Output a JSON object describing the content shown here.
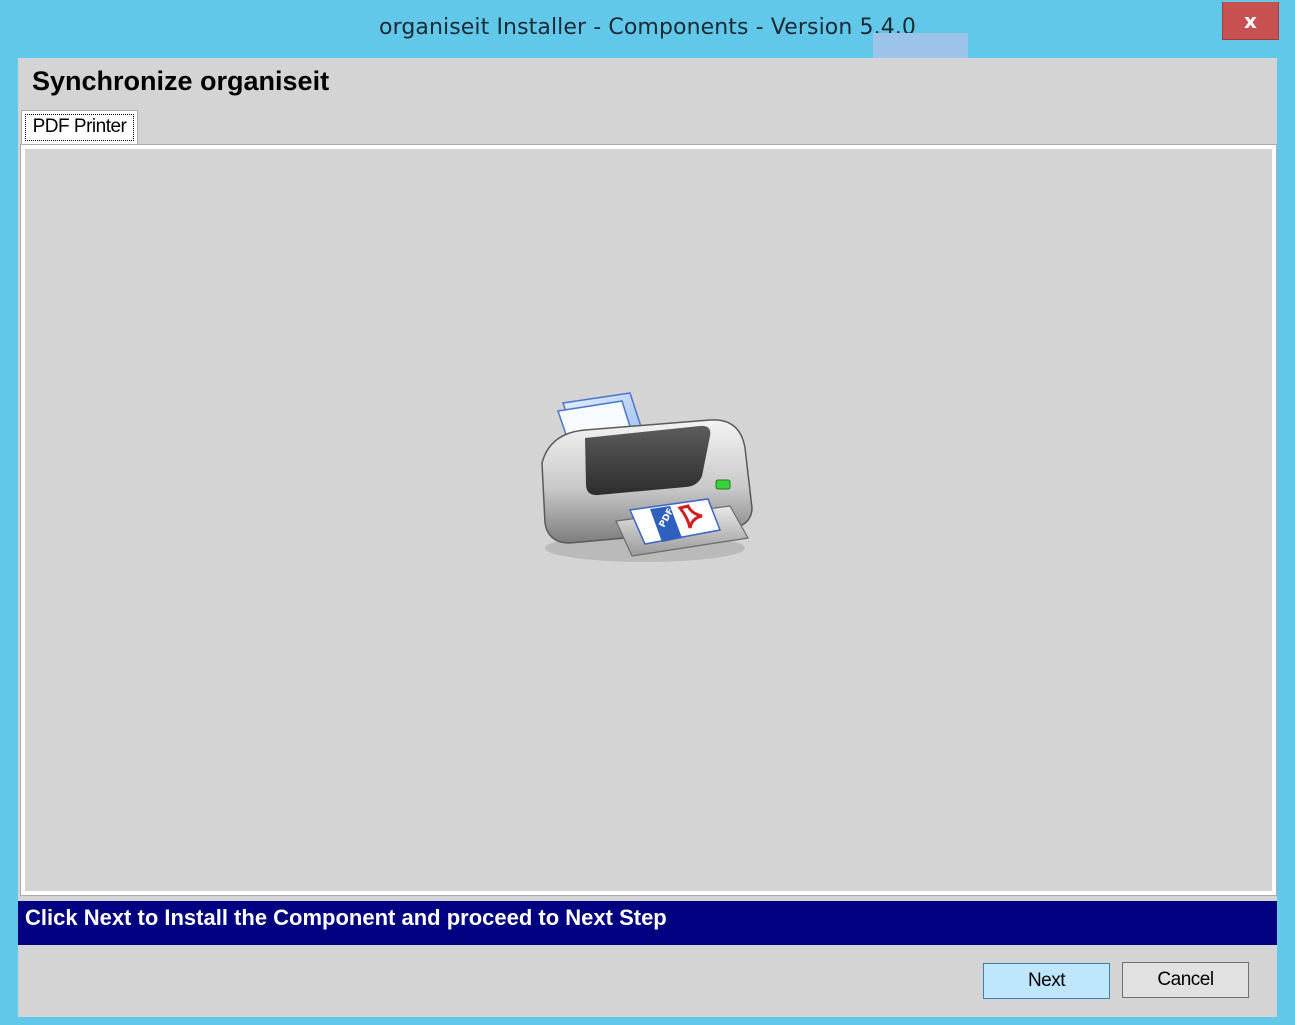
{
  "window": {
    "title": "organiseit Installer - Components - Version 5.4.0",
    "close_label": "x"
  },
  "page": {
    "heading": "Synchronize organiseit"
  },
  "tabs": [
    {
      "label": "PDF Printer",
      "selected": true
    }
  ],
  "content": {
    "image_icon": "pdf-printer-icon"
  },
  "instruction": {
    "text": "Click Next to Install the Component and proceed to Next Step"
  },
  "buttons": {
    "next_label": "Next",
    "cancel_label": "Cancel"
  },
  "colors": {
    "title_bar": "#62c8ea",
    "close_button": "#c75050",
    "instruction_bar": "#000080",
    "next_button": "#bee6fd"
  }
}
